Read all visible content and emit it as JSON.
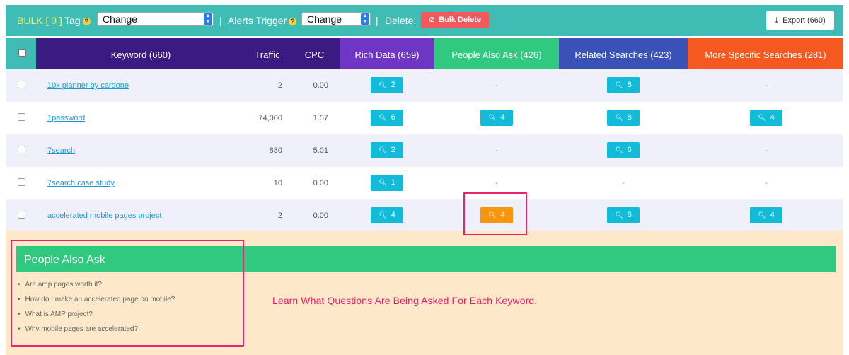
{
  "toolbar": {
    "bulk_label": "BULK [ 0 ]",
    "tag_label": "Tag",
    "tag_select_value": "Change",
    "sep1": "|",
    "alerts_label": "Alerts Trigger",
    "alerts_select_value": "Change",
    "sep2": "|",
    "delete_label": "Delete:",
    "bulk_delete_label": "Bulk Delete",
    "export_label": "Export (660)",
    "help_icon": "?"
  },
  "columns": {
    "keyword": "Keyword (660)",
    "traffic": "Traffic",
    "cpc": "CPC",
    "rich_data": "Rich Data (659)",
    "people_also_ask": "People Also Ask (426)",
    "related_searches": "Related Searches (423)",
    "more_specific": "More Specific Searches (281)"
  },
  "colors": {
    "toolbar": "#3fbcb4",
    "keyword_header": "#3b1a82",
    "rich_data": "#6f35c4",
    "people_also_ask": "#31c880",
    "related_searches": "#3a52b8",
    "more_specific": "#f5591f",
    "badge": "#12bcd9",
    "badge_active": "#f6960e",
    "highlight": "#e8246b"
  },
  "rows": [
    {
      "keyword": "10x planner by cardone",
      "traffic": "2",
      "cpc": "0.00",
      "rich_data": "2",
      "people_also_ask": "-",
      "related": "8",
      "more_specific": "-"
    },
    {
      "keyword": "1password",
      "traffic": "74,000",
      "cpc": "1.57",
      "rich_data": "6",
      "people_also_ask": "4",
      "related": "8",
      "more_specific": "4"
    },
    {
      "keyword": "7search",
      "traffic": "880",
      "cpc": "5.01",
      "rich_data": "2",
      "people_also_ask": "-",
      "related": "6",
      "more_specific": "-"
    },
    {
      "keyword": "7search case study",
      "traffic": "10",
      "cpc": "0.00",
      "rich_data": "1",
      "people_also_ask": "-",
      "related": "-",
      "more_specific": "-"
    },
    {
      "keyword": "accelerated mobile pages project",
      "traffic": "2",
      "cpc": "0.00",
      "rich_data": "4",
      "people_also_ask": "4",
      "related": "8",
      "more_specific": "4"
    }
  ],
  "paa_panel": {
    "title": "People Also Ask",
    "questions": [
      "Are amp pages worth it?",
      "How do I make an accelerated page on mobile?",
      "What is AMP project?",
      "Why mobile pages are accelerated?"
    ]
  },
  "tagline": "Learn What Questions Are Being Asked For Each Keyword."
}
